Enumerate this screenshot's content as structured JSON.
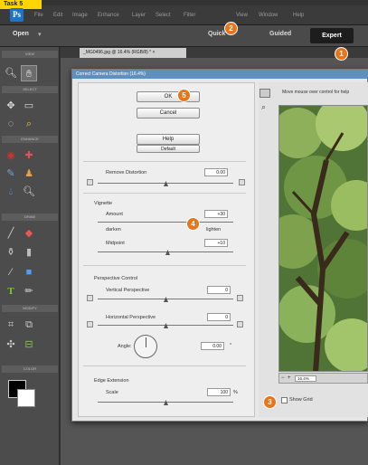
{
  "step_label": "Task 5",
  "menubar": {
    "app_logo": "Ps",
    "items": [
      "File",
      "Edit",
      "Image",
      "Enhance",
      "Layer",
      "Select",
      "Filter",
      "View",
      "Window",
      "Help"
    ]
  },
  "modebar": {
    "open_label": "Open",
    "open_arrow": "▾",
    "quick_label": "Quick",
    "guided_label": "Guided",
    "expert_label": "Expert"
  },
  "tools": {
    "sections": [
      "VIEW",
      "SELECT",
      "ENHANCE",
      "DRAW",
      "MODIFY",
      "COLOR"
    ]
  },
  "document": {
    "tab_label": "_MG0496.jpg @ 16.4% (RGB/8) * ×"
  },
  "dialog": {
    "title": "Correct Camera Distortion (16.4%)",
    "ok_label": "OK",
    "cancel_label": "Cancel",
    "help_label": "Help",
    "default_label": "Default",
    "remove_distortion": {
      "label": "Remove Distortion",
      "value": "0.00"
    },
    "vignette": {
      "heading": "Vignette",
      "amount": {
        "label": "Amount",
        "value": "+30"
      },
      "darken": {
        "label": "darken",
        "value": "lighten"
      },
      "midpoint": {
        "label": "Midpoint",
        "value": "+10"
      }
    },
    "perspective": {
      "heading": "Perspective Control",
      "vertical": {
        "label": "Vertical Perspective",
        "value": "0"
      },
      "horizontal": {
        "label": "Horizontal Perspective",
        "value": "0"
      },
      "angle": {
        "label": "Angle:",
        "value": "0.00",
        "unit": "°"
      }
    },
    "edge": {
      "heading": "Edge Extension",
      "scale": {
        "label": "Scale",
        "value": "100",
        "unit": "%"
      }
    },
    "preview": {
      "hint": "Move mouse over control for help",
      "zoom": "16.4%",
      "show_grid_label": "Show Grid"
    }
  },
  "badges": [
    "1",
    "2",
    "3",
    "4",
    "5"
  ],
  "colors": {
    "badge": "#e8751a",
    "dialog_title": "#5f8fbf",
    "step_label": "#ffd500"
  }
}
